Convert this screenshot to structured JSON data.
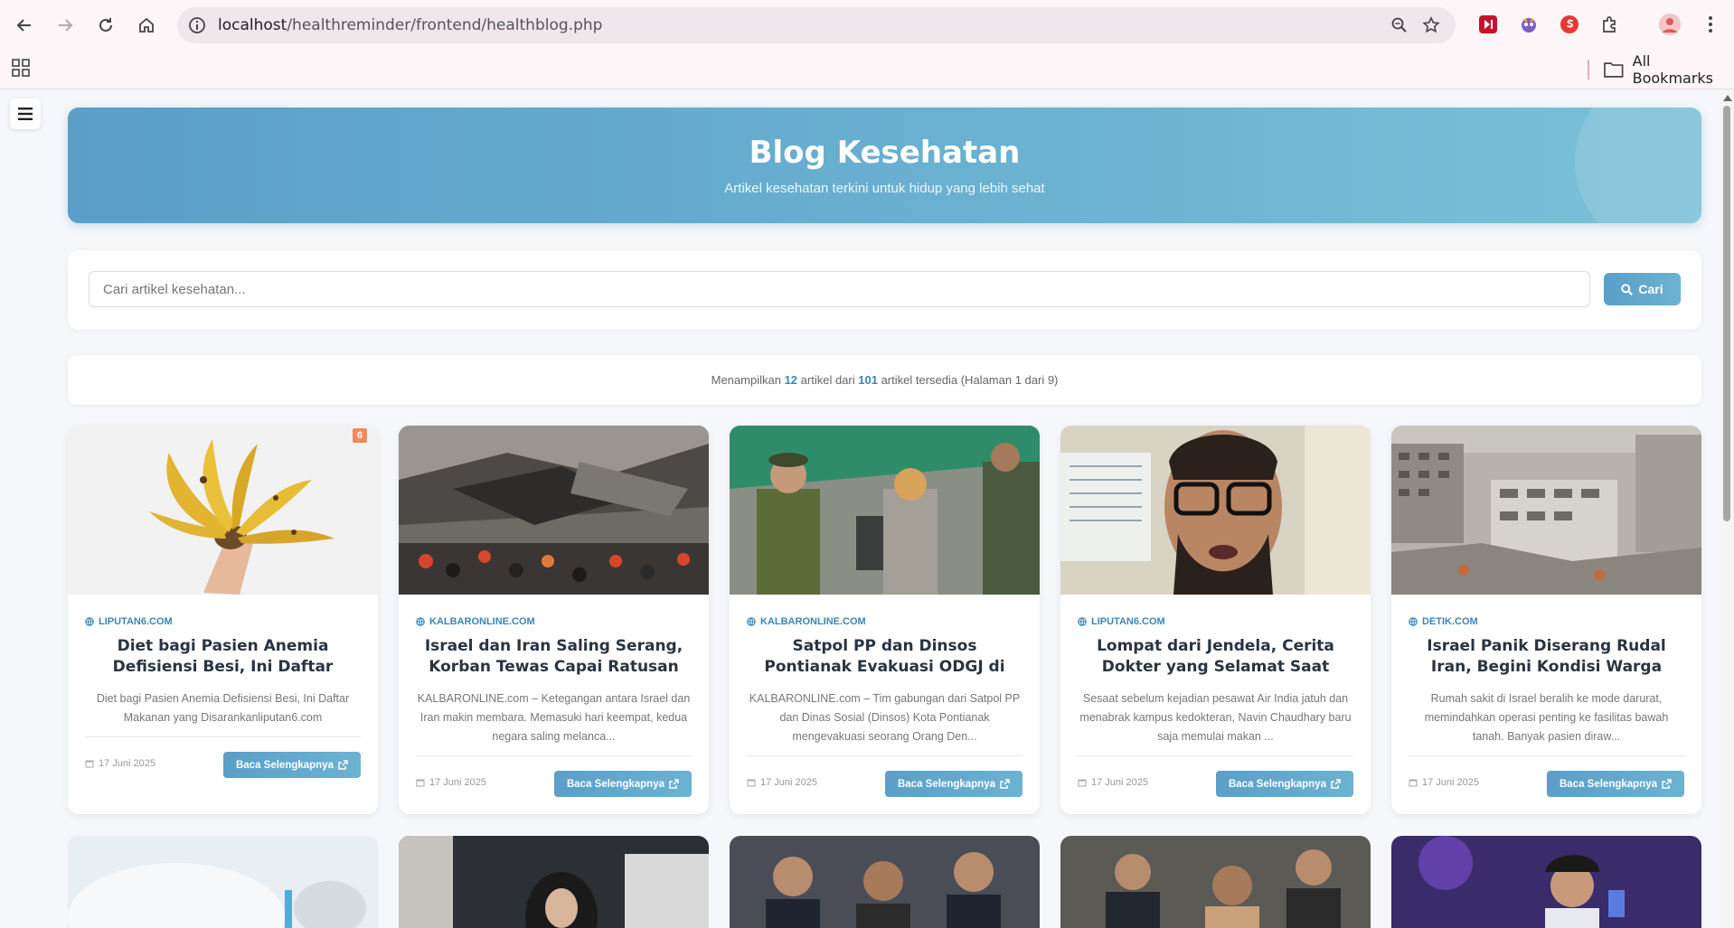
{
  "browser": {
    "url_host": "localhost",
    "url_path": "/healthreminder/frontend/healthblog.php",
    "all_bookmarks": "All Bookmarks"
  },
  "hero": {
    "title": "Blog Kesehatan",
    "subtitle": "Artikel kesehatan terkini untuk hidup yang lebih sehat"
  },
  "search": {
    "placeholder": "Cari artikel kesehatan...",
    "button_label": "Cari"
  },
  "summary": {
    "prefix": "Menampilkan",
    "shown": "12",
    "middle": "artikel dari",
    "total": "101",
    "suffix": "artikel tersedia (Halaman 1 dari 9)"
  },
  "articles": [
    {
      "badge": "6",
      "source": "LIPUTAN6.COM",
      "title": "Diet bagi Pasien Anemia Defisiensi Besi, Ini Daftar Makanan yang...",
      "description": "Diet bagi Pasien Anemia Defisiensi Besi, Ini Daftar Makanan yang Disarankanliputan6.com",
      "date": "17 Juni 2025",
      "button": "Baca Selengkapnya"
    },
    {
      "source": "KALBARONLINE.COM",
      "title": "Israel dan Iran Saling Serang, Korban Tewas Capai Ratusan dan Belum Ada...",
      "description": "KALBARONLINE.com – Ketegangan antara Israel dan Iran makin membara. Memasuki hari keempat, kedua negara saling melanca...",
      "date": "17 Juni 2025",
      "button": "Baca Selengkapnya"
    },
    {
      "source": "KALBARONLINE.COM",
      "title": "Satpol PP dan Dinsos Pontianak Evakuasi ODGJ di Jalan Rajawali,...",
      "description": "KALBARONLINE.com – Tim gabungan dari Satpol PP dan Dinas Sosial (Dinsos) Kota Pontianak mengevakuasi seorang Orang Den...",
      "date": "17 Juni 2025",
      "button": "Baca Selengkapnya"
    },
    {
      "source": "LIPUTAN6.COM",
      "title": "Lompat dari Jendela, Cerita Dokter yang Selamat Saat Pesawat Air India...",
      "description": "Sesaat sebelum kejadian pesawat Air India jatuh dan menabrak kampus kedokteran, Navin Chaudhary baru saja memulai makan ...",
      "date": "17 Juni 2025",
      "button": "Baca Selengkapnya"
    },
    {
      "source": "DETIK.COM",
      "title": "Israel Panik Diserang Rudal Iran, Begini Kondisi Warga yang Dirawat ...",
      "description": "Rumah sakit di Israel beralih ke mode darurat, memindahkan operasi penting ke fasilitas bawah tanah. Banyak pasien diraw...",
      "date": "17 Juni 2025",
      "button": "Baca Selengkapnya"
    }
  ]
}
